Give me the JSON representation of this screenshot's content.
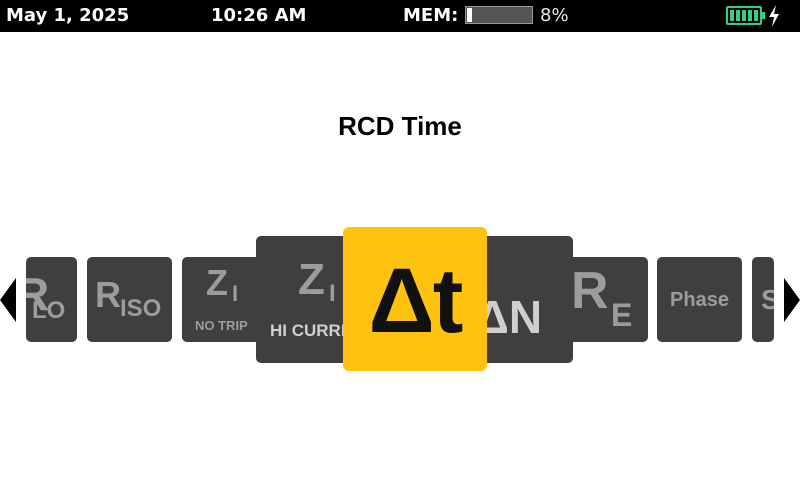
{
  "status_bar": {
    "date": "May 1, 2025",
    "time": "10:26 AM",
    "mem_label": "MEM:",
    "mem_percent": "8%",
    "mem_fraction": 0.08,
    "battery_icon": "battery-full-icon",
    "charging_icon": "lightning-bolt-icon",
    "battery_color": "#33cc88"
  },
  "page": {
    "title": "RCD Time"
  },
  "carousel": {
    "selected": {
      "symbol": "Δt",
      "color": "#ffc20e"
    },
    "tiles": {
      "rlo": {
        "main": "R",
        "sub": "LO"
      },
      "riso": {
        "main": "R",
        "sub": "ISO"
      },
      "zi_notrip": {
        "main": "Z",
        "sub": "I",
        "caption": "NO TRIP"
      },
      "zi_hicurr": {
        "main": "Z",
        "sub": "I",
        "caption": "HI CURRENT"
      },
      "idn": {
        "main": "IΔN"
      },
      "re": {
        "main": "R",
        "sub": "E"
      },
      "phase": {
        "main": "Phase"
      },
      "next": {
        "main": "S"
      }
    },
    "tile_color": "#3f3f3f",
    "left_arrow_icon": "triangle-left-icon",
    "right_arrow_icon": "triangle-right-icon"
  }
}
